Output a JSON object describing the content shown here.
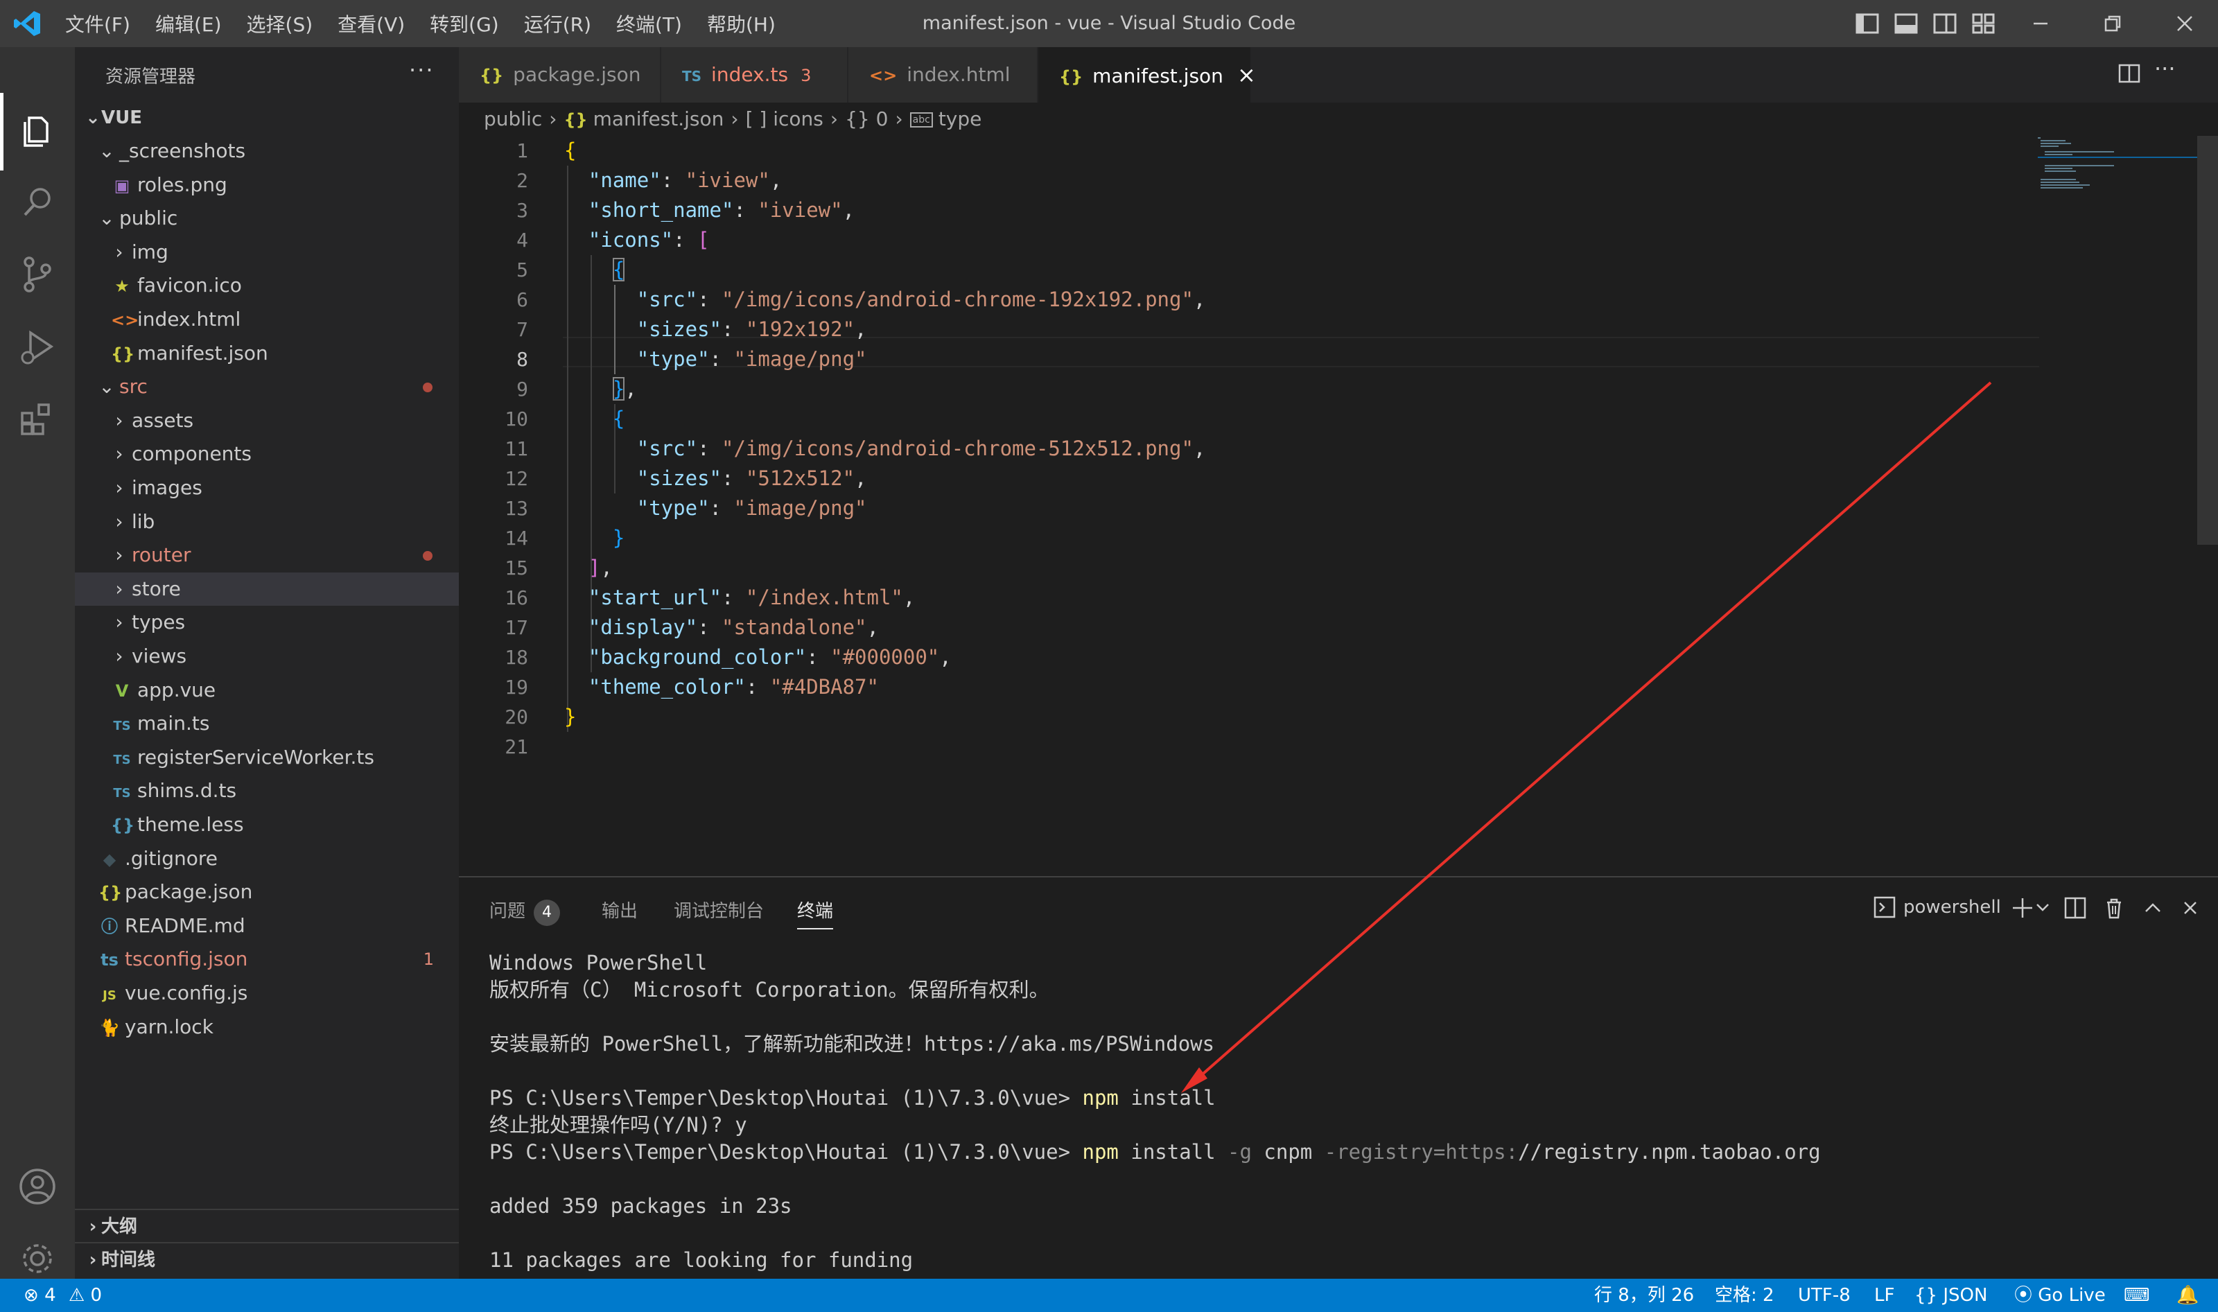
{
  "app": {
    "window_title": "manifest.json - vue - Visual Studio Code",
    "menu": [
      "文件(F)",
      "编辑(E)",
      "选择(S)",
      "查看(V)",
      "转到(G)",
      "运行(R)",
      "终端(T)",
      "帮助(H)"
    ]
  },
  "sidebar": {
    "title": "资源管理器",
    "more": "···",
    "root": "VUE",
    "tree": [
      {
        "label": "_screenshots",
        "kind": "folder-open",
        "depth": 1
      },
      {
        "label": "roles.png",
        "kind": "image",
        "depth": 2
      },
      {
        "label": "public",
        "kind": "folder-open",
        "depth": 1
      },
      {
        "label": "img",
        "kind": "folder",
        "depth": 2
      },
      {
        "label": "favicon.ico",
        "kind": "star",
        "depth": 2
      },
      {
        "label": "index.html",
        "kind": "html",
        "depth": 2
      },
      {
        "label": "manifest.json",
        "kind": "json",
        "depth": 2
      },
      {
        "label": "src",
        "kind": "folder-open",
        "depth": 1,
        "modified": true
      },
      {
        "label": "assets",
        "kind": "folder",
        "depth": 2
      },
      {
        "label": "components",
        "kind": "folder",
        "depth": 2
      },
      {
        "label": "images",
        "kind": "folder",
        "depth": 2
      },
      {
        "label": "lib",
        "kind": "folder",
        "depth": 2
      },
      {
        "label": "router",
        "kind": "folder",
        "depth": 2,
        "modified": true
      },
      {
        "label": "store",
        "kind": "folder",
        "depth": 2,
        "selected": true
      },
      {
        "label": "types",
        "kind": "folder",
        "depth": 2
      },
      {
        "label": "views",
        "kind": "folder",
        "depth": 2
      },
      {
        "label": "app.vue",
        "kind": "vue",
        "depth": 2
      },
      {
        "label": "main.ts",
        "kind": "ts",
        "depth": 2
      },
      {
        "label": "registerServiceWorker.ts",
        "kind": "ts",
        "depth": 2
      },
      {
        "label": "shims.d.ts",
        "kind": "ts",
        "depth": 2
      },
      {
        "label": "theme.less",
        "kind": "less",
        "depth": 2
      },
      {
        "label": ".gitignore",
        "kind": "git",
        "depth": 1
      },
      {
        "label": "package.json",
        "kind": "json",
        "depth": 1
      },
      {
        "label": "README.md",
        "kind": "info",
        "depth": 1
      },
      {
        "label": "tsconfig.json",
        "kind": "tsconfig",
        "depth": 1,
        "errors": "1"
      },
      {
        "label": "vue.config.js",
        "kind": "js",
        "depth": 1
      },
      {
        "label": "yarn.lock",
        "kind": "yarn",
        "depth": 1
      }
    ],
    "outline": "大纲",
    "timeline": "时间线"
  },
  "tabs": [
    {
      "label": "package.json",
      "icon": "{}",
      "active": false
    },
    {
      "label": "index.ts",
      "icon": "TS",
      "active": false,
      "count": "3",
      "error": true
    },
    {
      "label": "index.html",
      "icon": "<>",
      "active": false
    },
    {
      "label": "manifest.json",
      "icon": "{}",
      "active": true,
      "close": "×"
    }
  ],
  "breadcrumb": [
    "public",
    "manifest.json",
    "[ ] icons",
    "{} 0",
    "type"
  ],
  "editor": {
    "current_line": 8,
    "line_numbers": [
      "1",
      "2",
      "3",
      "4",
      "5",
      "6",
      "7",
      "8",
      "9",
      "10",
      "11",
      "12",
      "13",
      "14",
      "15",
      "16",
      "17",
      "18",
      "19",
      "20",
      "21"
    ]
  },
  "panel": {
    "tabs": [
      "问题",
      "输出",
      "调试控制台",
      "终端"
    ],
    "problems_count": "4",
    "active_tab": "终端",
    "shell": "powershell",
    "terminal_lines": [
      "Windows PowerShell",
      "版权所有（C） Microsoft Corporation。保留所有权利。",
      "",
      "安装最新的 PowerShell，了解新功能和改进！https://aka.ms/PSWindows",
      "",
      "PS C:\\Users\\Temper\\Desktop\\Houtai (1)\\7.3.0\\vue> npm install",
      "终止批处理操作吗(Y/N)? y",
      "PS C:\\Users\\Temper\\Desktop\\Houtai (1)\\7.3.0\\vue> npm install -g cnpm -registry=https://registry.npm.taobao.org",
      "",
      "added 359 packages in 23s",
      "",
      "11 packages are looking for funding"
    ],
    "prompt": "PS C:\\Users\\Temper\\Desktop\\Houtai (1)\\7.3.0\\vue> ",
    "cmd1": "npm",
    "cmd1_rest": " install",
    "cmd2": "npm",
    "cmd2_rest": " install ",
    "cmd2_flag": "-g",
    "cmd2_pkg": " cnpm ",
    "cmd2_reg": "-registry=https:",
    "cmd2_url": "//registry.npm.taobao.org"
  },
  "status": {
    "errors": "4",
    "warnings": "0",
    "cursor": "行 8，列 26",
    "indent": "空格: 2",
    "encoding": "UTF-8",
    "eol": "LF",
    "language": "{} JSON",
    "golive": "Go Live"
  },
  "colors": {
    "accent": "#007acc",
    "arrow": "#e8312a",
    "error_text": "#f48771"
  }
}
